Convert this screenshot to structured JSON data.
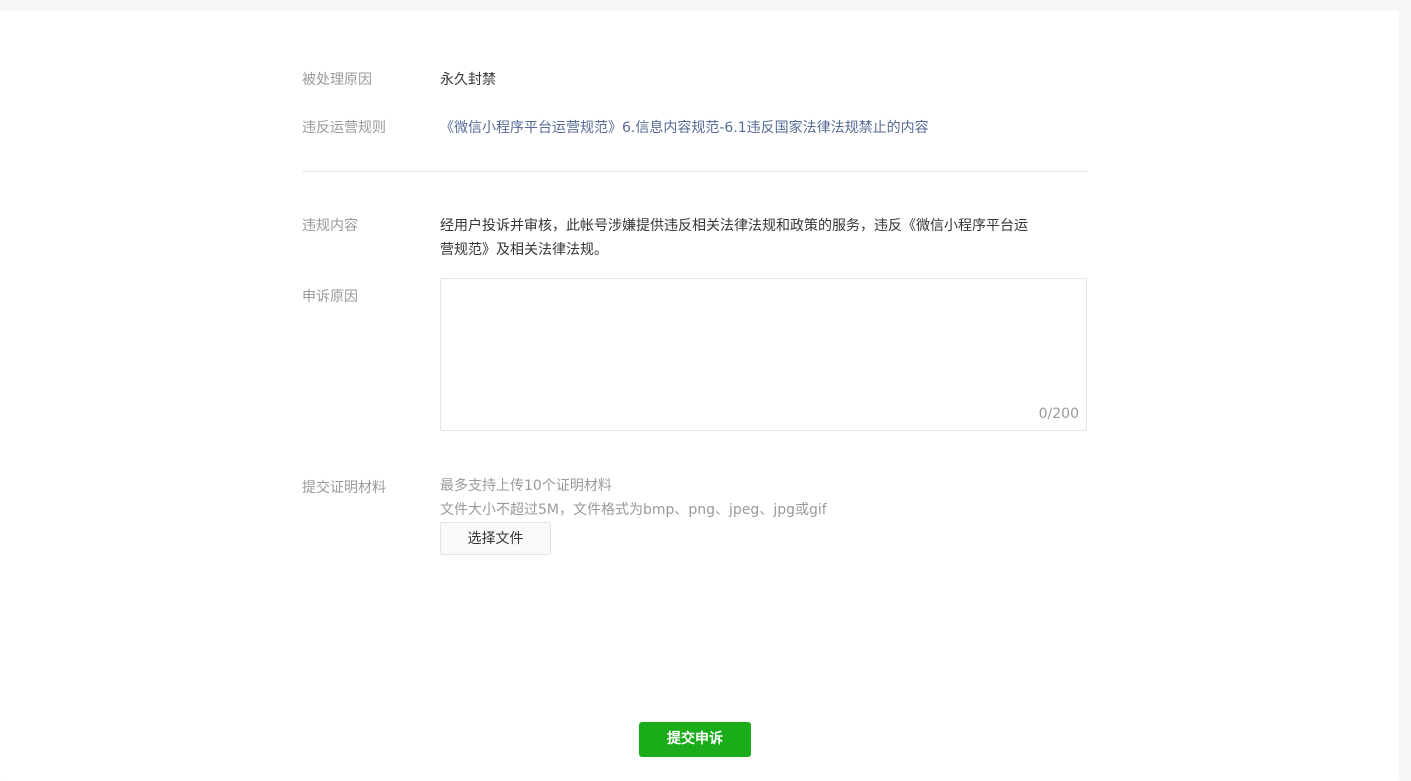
{
  "form": {
    "reason": {
      "label": "被处理原因",
      "value": "永久封禁"
    },
    "rule": {
      "label": "违反运营规则",
      "value": "《微信小程序平台运营规范》6.信息内容规范-6.1违反国家法律法规禁止的内容"
    },
    "violation": {
      "label": "违规内容",
      "value_line1": "经用户投诉并审核，此帐号涉嫌提供违反相关法律法规和政策的服务，违反《微信小程序平台运",
      "value_line2": "营规范》及相关法律法规。"
    },
    "appeal": {
      "label": "申诉原因",
      "value": "",
      "placeholder": "",
      "counter": "0/200"
    },
    "evidence": {
      "label": "提交证明材料",
      "hint1": "最多支持上传10个证明材料",
      "hint2": "文件大小不超过5M，文件格式为bmp、png、jpeg、jpg或gif",
      "choose_file_label": "选择文件"
    },
    "submit_label": "提交申诉"
  },
  "colors": {
    "primary_green": "#1aad19",
    "link": "#576b95",
    "label_gray": "#9a9a9a",
    "text": "#353535"
  }
}
